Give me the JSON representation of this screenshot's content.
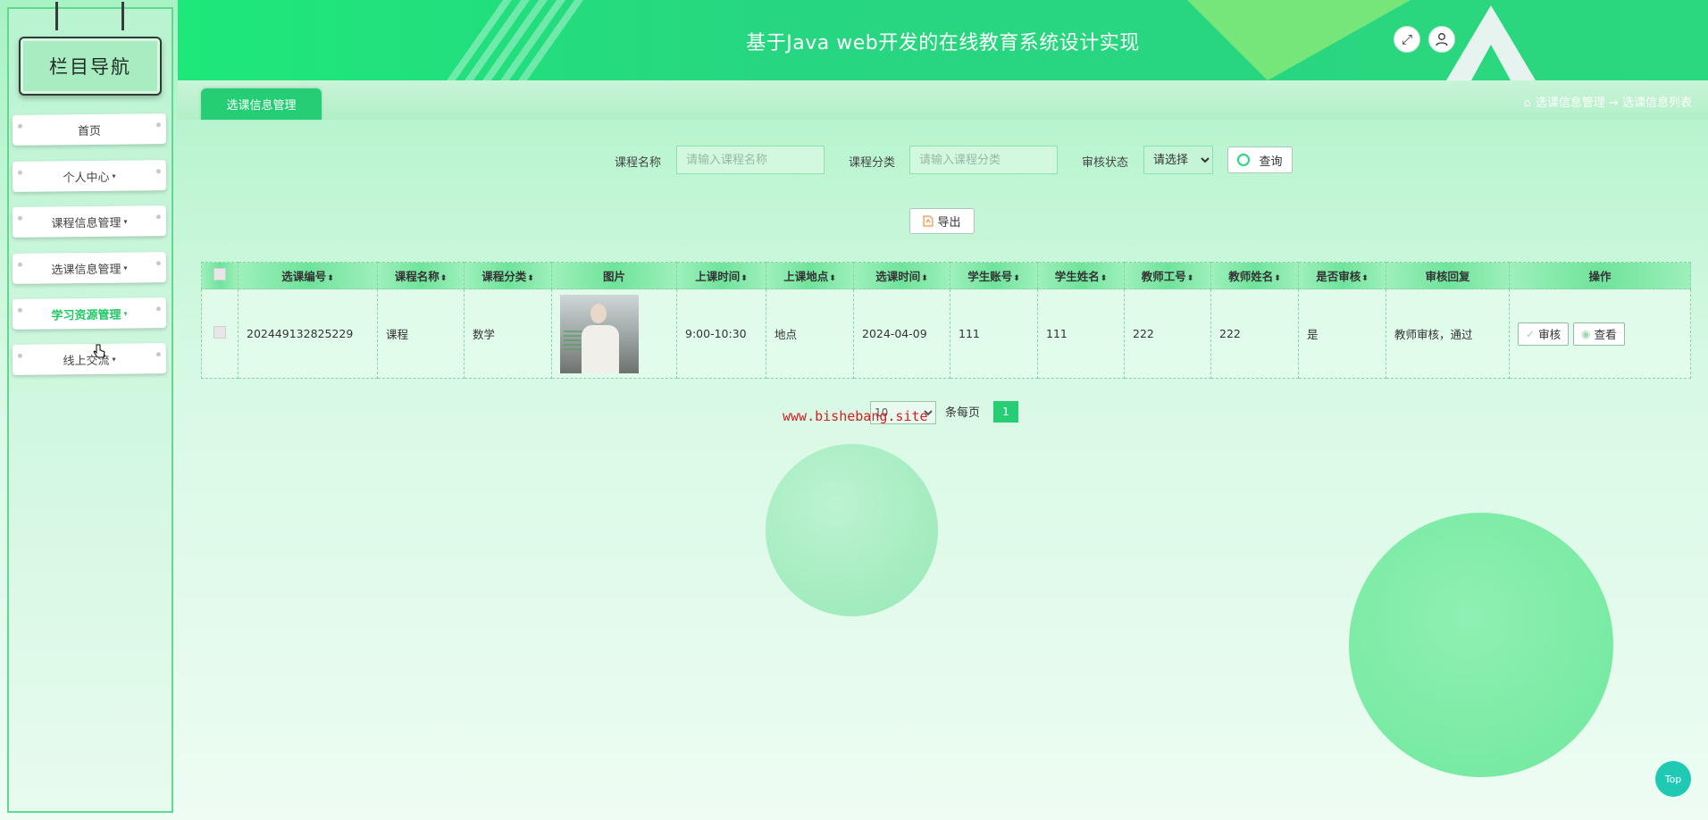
{
  "header": {
    "title": "基于Java web开发的在线教育系统设计实现",
    "fullscreen_icon": "expand-icon",
    "user_icon": "user-icon"
  },
  "sidebar": {
    "title": "栏目导航",
    "items": [
      {
        "label": "首页",
        "caret": ""
      },
      {
        "label": "个人中心",
        "caret": "▾"
      },
      {
        "label": "课程信息管理",
        "caret": "▾"
      },
      {
        "label": "选课信息管理",
        "caret": "▾"
      },
      {
        "label": "学习资源管理",
        "caret": "▾",
        "active": true
      },
      {
        "label": "线上交流",
        "caret": "▾"
      }
    ]
  },
  "tab": {
    "label": "选课信息管理"
  },
  "breadcrumb": {
    "home_icon": "⌂",
    "path": "选课信息管理 → 选课信息列表"
  },
  "search": {
    "course_name_label": "课程名称",
    "course_name_placeholder": "请输入课程名称",
    "course_category_label": "课程分类",
    "course_category_placeholder": "请输入课程分类",
    "audit_status_label": "审核状态",
    "audit_status_value": "请选择",
    "query_label": "查询",
    "export_label": "导出"
  },
  "table": {
    "columns": [
      "选课编号",
      "课程名称",
      "课程分类",
      "图片",
      "上课时间",
      "上课地点",
      "选课时间",
      "学生账号",
      "学生姓名",
      "教师工号",
      "教师姓名",
      "是否审核",
      "审核回复",
      "操作"
    ],
    "sortable": [
      true,
      true,
      true,
      false,
      true,
      true,
      true,
      true,
      true,
      true,
      true,
      true,
      false,
      false
    ],
    "rows": [
      {
        "id": "202449132825229",
        "course_name": "课程",
        "category": "数学",
        "image": "course-photo",
        "class_time": "9:00-10:30",
        "location": "地点",
        "select_time": "2024-04-09",
        "student_account": "111",
        "student_name": "111",
        "teacher_id": "222",
        "teacher_name": "222",
        "audited": "是",
        "reply": "教师审核，通过"
      }
    ],
    "actions": {
      "audit_label": "审核",
      "view_label": "查看"
    }
  },
  "pagination": {
    "page_size": "10",
    "per_page_text": "条每页",
    "current_page": "1"
  },
  "watermark": "www.bishebang.site",
  "top_button": "Top",
  "colors": {
    "accent": "#25cd75",
    "header": "#27d680"
  }
}
